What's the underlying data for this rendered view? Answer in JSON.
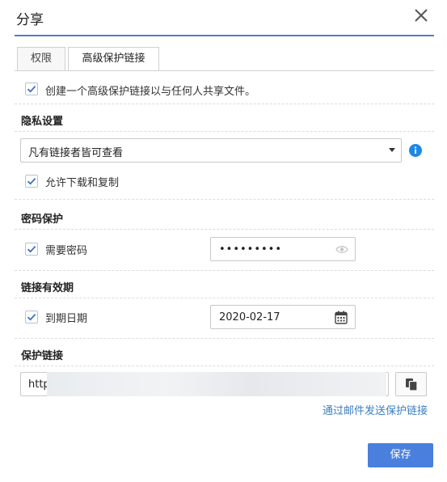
{
  "dialog": {
    "title": "分享"
  },
  "tabs": [
    {
      "label": "权限",
      "active": false
    },
    {
      "label": "高级保护链接",
      "active": true
    }
  ],
  "enable_advanced": {
    "checked": true,
    "label": "创建一个高级保护链接以与任何人共享文件。"
  },
  "privacy": {
    "heading": "隐私设置",
    "access_select": "凡有链接者皆可查看",
    "allow_download": {
      "checked": true,
      "label": "允许下载和复制"
    }
  },
  "password": {
    "heading": "密码保护",
    "require": {
      "checked": true,
      "label": "需要密码"
    },
    "value": "•••••••••"
  },
  "expiry": {
    "heading": "链接有效期",
    "enable": {
      "checked": true,
      "label": "到期日期"
    },
    "date": "2020-02-17"
  },
  "protected_link": {
    "heading": "保护链接",
    "url_prefix": "http",
    "email_link": "通过邮件发送保护链接"
  },
  "footer": {
    "save_label": "保存"
  },
  "colors": {
    "accent": "#4a7fde",
    "link": "#3c7fc1",
    "info": "#1e88e5"
  }
}
